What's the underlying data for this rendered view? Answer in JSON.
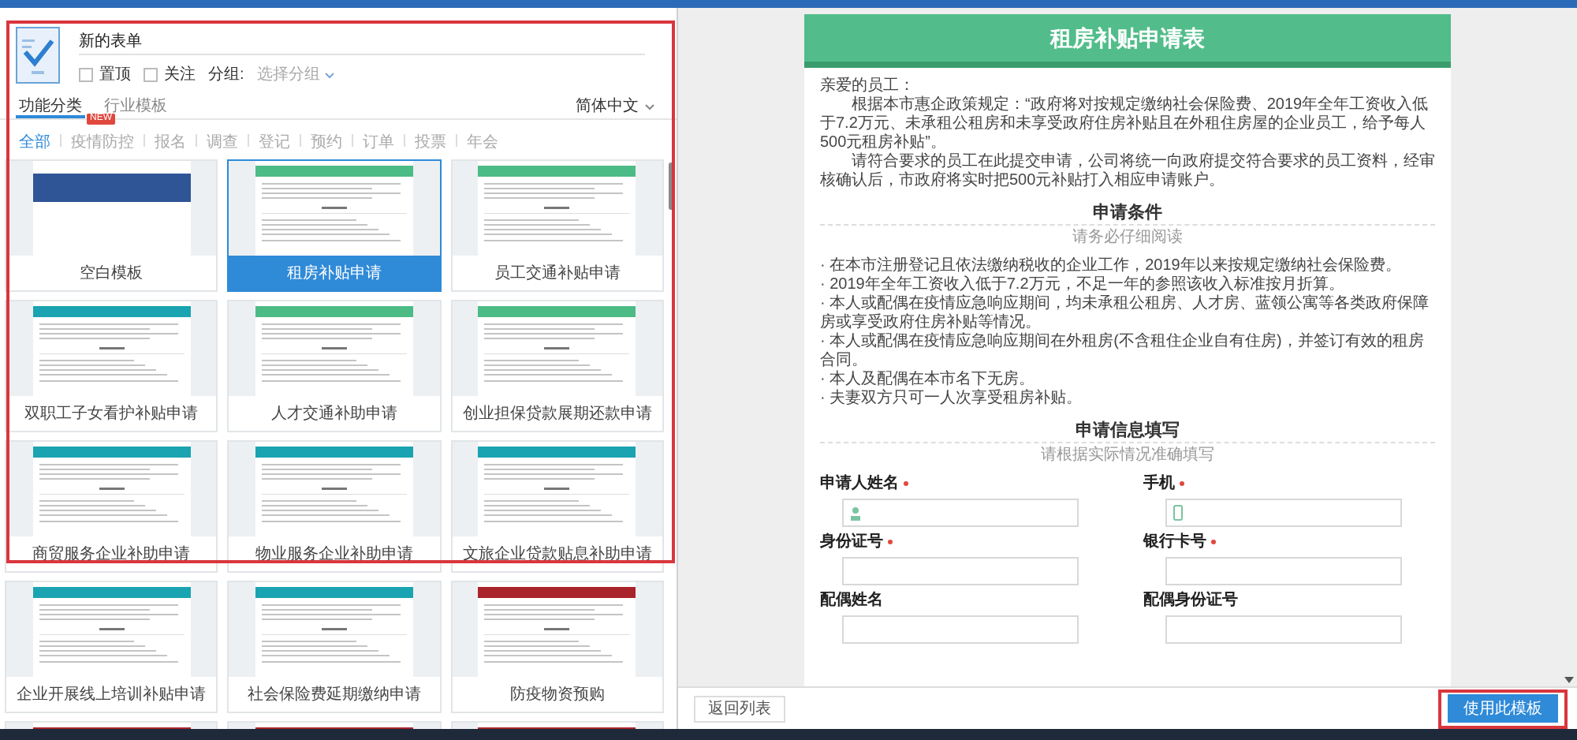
{
  "left_panel": {
    "highlighted": true,
    "form_header": {
      "title": "新的表单",
      "options": [
        {
          "label": "置顶",
          "checked": false
        },
        {
          "label": "关注",
          "checked": false
        }
      ],
      "group_label": "分组:",
      "group_placeholder": "选择分组"
    },
    "tabs": [
      {
        "label": "功能分类",
        "selected": true
      },
      {
        "label": "行业模板",
        "selected": false
      }
    ],
    "language": "简体中文",
    "filters": [
      {
        "label": "全部",
        "selected": true
      },
      {
        "label": "疫情防控",
        "selected": false,
        "badge": "NEW"
      },
      {
        "label": "报名",
        "selected": false
      },
      {
        "label": "调查",
        "selected": false
      },
      {
        "label": "登记",
        "selected": false
      },
      {
        "label": "预约",
        "selected": false
      },
      {
        "label": "订单",
        "selected": false
      },
      {
        "label": "投票",
        "selected": false
      },
      {
        "label": "年会",
        "selected": false
      }
    ],
    "templates": [
      {
        "title": "空白模板",
        "kind": "blank",
        "color": "#2f5597",
        "selected": false
      },
      {
        "title": "租房补贴申请",
        "kind": "form",
        "color": "#4dbb85",
        "selected": true
      },
      {
        "title": "员工交通补贴申请",
        "kind": "form",
        "color": "#4dbb85",
        "selected": false
      },
      {
        "title": "双职工子女看护补贴申请",
        "kind": "form",
        "color": "#1aa3b0",
        "selected": false
      },
      {
        "title": "人才交通补助申请",
        "kind": "form",
        "color": "#4dbb85",
        "selected": false
      },
      {
        "title": "创业担保贷款展期还款申请",
        "kind": "form",
        "color": "#4dbb85",
        "selected": false
      },
      {
        "title": "商贸服务企业补助申请",
        "kind": "form",
        "color": "#1aa3b0",
        "selected": false
      },
      {
        "title": "物业服务企业补助申请",
        "kind": "form",
        "color": "#1aa3b0",
        "selected": false
      },
      {
        "title": "文旅企业贷款贴息补助申请",
        "kind": "form",
        "color": "#1aa3b0",
        "selected": false
      },
      {
        "title": "企业开展线上培训补贴申请",
        "kind": "form",
        "color": "#1aa3b0",
        "selected": false
      },
      {
        "title": "社会保险费延期缴纳申请",
        "kind": "form",
        "color": "#1aa3b0",
        "selected": false
      },
      {
        "title": "防疫物资预购",
        "kind": "form",
        "color": "#a8232a",
        "selected": false
      },
      {
        "kind": "form",
        "color": "#a8232a",
        "selected": false
      },
      {
        "kind": "form",
        "color": "#a8232a",
        "selected": false
      },
      {
        "kind": "form",
        "color": "#a8232a",
        "selected": false
      }
    ]
  },
  "preview": {
    "title": "租房补贴申请表",
    "greeting": "亲爱的员工：",
    "paragraphs": [
      "根据本市惠企政策规定：“政府将对按规定缴纳社会保险费、2019年全年工资收入低于7.2万元、未承租公租房和未享受政府住房补贴且在外租住房屋的企业员工，给予每人500元租房补贴”。",
      "请符合要求的员工在此提交申请，公司将统一向政府提交符合要求的员工资料，经审核确认后，市政府将实时把500元补贴打入相应申请账户。"
    ],
    "sections": [
      {
        "title": "申请条件",
        "subtitle": "请务必仔细阅读",
        "items": [
          "· 在本市注册登记且依法缴纳税收的企业工作，2019年以来按规定缴纳社会保险费。",
          "· 2019年全年工资收入低于7.2万元，不足一年的参照该收入标准按月折算。",
          "· 本人或配偶在疫情应急响应期间，均未承租公租房、人才房、蓝领公寓等各类政府保障房或享受政府住房补贴等情况。",
          "· 本人或配偶在疫情应急响应期间在外租房(不含租住企业自有住房)，并签订有效的租房合同。",
          "· 本人及配偶在本市名下无房。",
          "· 夫妻双方只可一人次享受租房补贴。"
        ]
      },
      {
        "title": "申请信息填写",
        "subtitle": "请根据实际情况准确填写",
        "fields": [
          {
            "label": "申请人姓名",
            "required": true
          },
          {
            "label": "手机",
            "required": true
          },
          {
            "label": "身份证号",
            "required": true
          },
          {
            "label": "银行卡号",
            "required": true
          },
          {
            "label": "配偶姓名",
            "required": false
          },
          {
            "label": "配偶身份证号",
            "required": false
          }
        ]
      }
    ]
  },
  "footer": {
    "back_button": "返回列表",
    "use_button": {
      "label": "使用此模板",
      "highlighted": true
    }
  }
}
